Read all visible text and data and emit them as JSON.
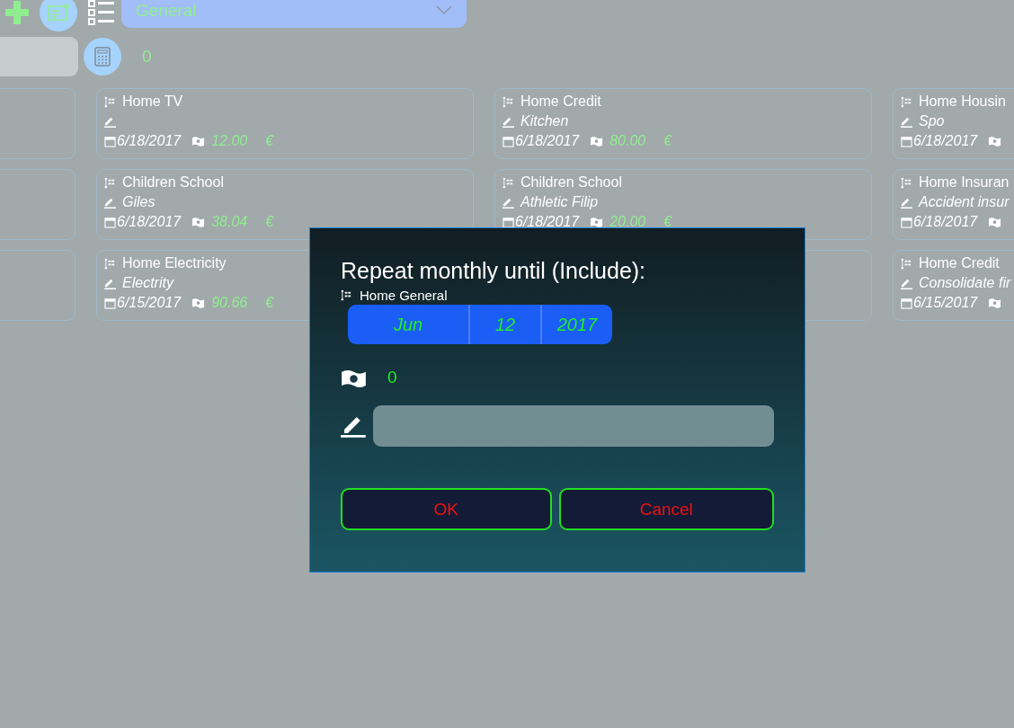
{
  "toolbar": {
    "category": "General",
    "total": "0"
  },
  "cards": [
    [
      {
        "kind": "blank"
      },
      {
        "kind": "entry",
        "category": "Home TV",
        "date": "6/18/2017",
        "amount": "12.00",
        "currency": "€"
      },
      {
        "kind": "entry",
        "category": "Home Credit",
        "note": "Kitchen",
        "date": "6/18/2017",
        "amount": "80.00",
        "currency": "€"
      },
      {
        "kind": "entry",
        "category": "Home Housin",
        "note": "Spo",
        "date": "6/18/2017"
      }
    ],
    [
      {
        "kind": "blank"
      },
      {
        "kind": "entry",
        "category": "Children School",
        "note": "Giles",
        "date": "6/18/2017",
        "amount": "38.04",
        "currency": "€"
      },
      {
        "kind": "entry",
        "category": "Children School",
        "note": "Athletic Filip",
        "date": "6/18/2017",
        "amount": "20.00",
        "currency": "€"
      },
      {
        "kind": "entry",
        "category": "Home Insuran",
        "note": "Accident insur",
        "date": "6/18/2017"
      }
    ],
    [
      {
        "kind": "blank"
      },
      {
        "kind": "entry",
        "category": "Home Electricity",
        "note": "Electrity",
        "date": "6/15/2017",
        "amount": "90.66",
        "currency": "€"
      },
      {
        "kind": "blank"
      },
      {
        "kind": "entry",
        "category": "Home Credit",
        "note": "Consolidate fir",
        "date": "6/15/2017"
      }
    ]
  ],
  "dialog": {
    "title": "Repeat monthly until (Include):",
    "category": "Home General",
    "date": {
      "month": "Jun",
      "day": "12",
      "year": "2017"
    },
    "amount": "0",
    "buttons": [
      {
        "label": "OK",
        "kind": "ok"
      },
      {
        "label": "Cancel",
        "kind": "cancel"
      }
    ]
  }
}
